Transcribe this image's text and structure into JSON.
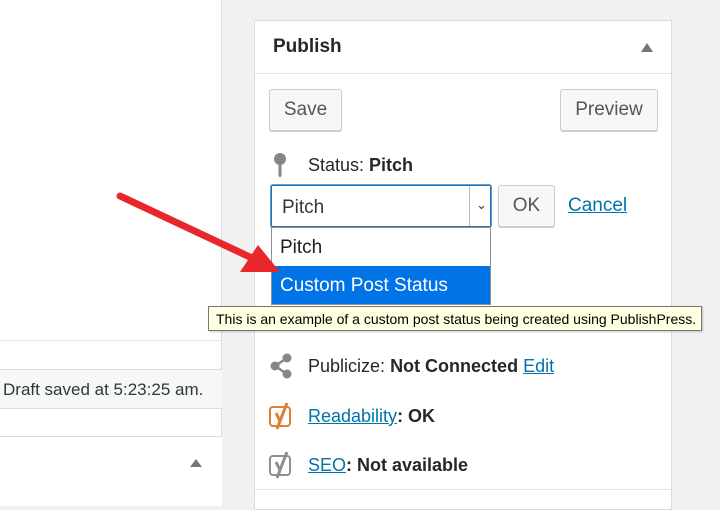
{
  "editor": {
    "draft_status": "Draft saved at 5:23:25 am."
  },
  "publish_box": {
    "title": "Publish",
    "save_label": "Save",
    "preview_label": "Preview",
    "status_label": "Status:",
    "status_value": "Pitch",
    "select": {
      "current_value": "Pitch",
      "options": [
        "Pitch",
        "Custom Post Status"
      ],
      "highlighted_option": "Custom Post Status"
    },
    "ok_label": "OK",
    "cancel_label": "Cancel",
    "tooltip": "This is an example of a custom post status being created using PublishPress.",
    "publicize": {
      "label": "Publicize:",
      "value": "Not Connected",
      "link": "Edit"
    },
    "readability": {
      "link": "Readability",
      "value": ": OK"
    },
    "seo": {
      "link": "SEO",
      "value": ": Not available"
    }
  },
  "colors": {
    "accent": "#0073aa",
    "selection": "#0073e6",
    "annotation_arrow": "#e8262b",
    "yoast_orange": "#e17f2d",
    "yoast_gray": "#8c8f94"
  },
  "icons": {
    "status": "pin-icon",
    "publicize": "share-icon",
    "readability": "yoast-icon",
    "seo": "yoast-icon",
    "collapse": "triangle-up-icon",
    "select_arrow": "chevron-down-icon"
  }
}
